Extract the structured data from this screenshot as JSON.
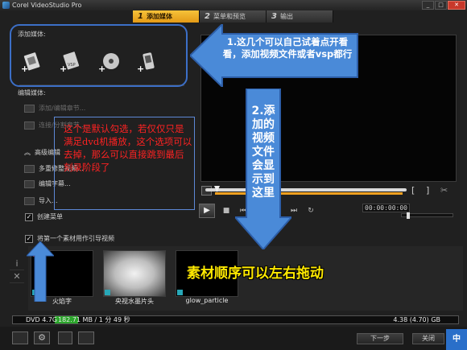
{
  "window": {
    "title": "Corel VideoStudio Pro",
    "min": "_",
    "max": "□",
    "close": "✕"
  },
  "tabs": [
    {
      "num": "1",
      "label": "添加媒体",
      "active": true
    },
    {
      "num": "2",
      "label": "菜单和预览",
      "active": false
    },
    {
      "num": "3",
      "label": "输出",
      "active": false
    }
  ],
  "left": {
    "add_media_label": "添加媒体:",
    "media_icons": [
      "add-video-icon",
      "add-vsp-icon",
      "add-disc-icon",
      "add-device-icon"
    ],
    "edit_media_label": "编辑媒体:",
    "edit_items": [
      "添加/编辑章节...",
      "连接/分割章节..."
    ],
    "advanced_label": "高级编辑",
    "advanced_items": [
      "多重修整视频...",
      "编辑字幕...",
      "导入..."
    ],
    "create_menu": "创建菜单",
    "first_clip_intro": "将第一个素材用作引导视频"
  },
  "player": {
    "timecode": "00:00:00:00",
    "mark_in": "[",
    "mark_out": "]",
    "cut": "✂"
  },
  "clips": [
    {
      "label": "火焰字"
    },
    {
      "label": "央视水墨片头"
    },
    {
      "label": "glow_particle"
    }
  ],
  "status": {
    "disc": "DVD 4.7G",
    "used": "182.71 MB / 1 分 49 秒",
    "capacity": "4.38 (4.70) GB"
  },
  "bottom": {
    "next": "下一步",
    "close": "关闭",
    "ime": "中"
  },
  "annotations": {
    "arrow1": "1.这几个可以自己试着点开看看，添加视频文件或者vsp都行",
    "arrow2": "2.添加的视频文件会显示到这里",
    "note": "这个是默认勾选，若仅仅只是满足dvd机播放，这个选项可以去掉，那么可以直接跳到最后刻录阶段了",
    "order": "素材顺序可以左右拖动"
  },
  "colors": {
    "accent": "#f0a020",
    "annotation_blue": "#4a8ad8",
    "annotation_red": "#ff2222",
    "annotation_yellow": "#ffe900"
  }
}
